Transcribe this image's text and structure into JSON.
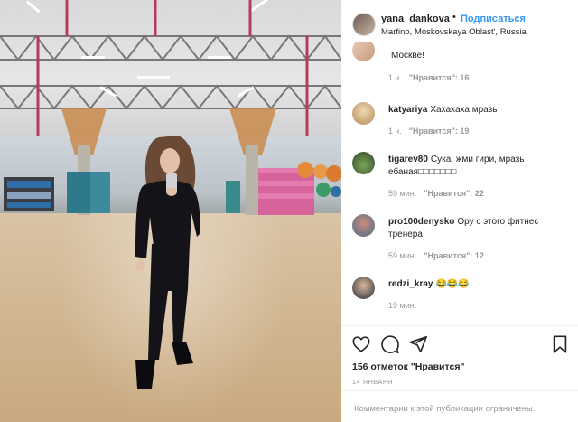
{
  "header": {
    "username": "yana_dankova",
    "separator": "•",
    "follow_label": "Подписаться",
    "location": "Marfino, Moskovskaya Oblast', Russia"
  },
  "comments": [
    {
      "username": "",
      "text": "Москве!",
      "time": "1 ч.",
      "like_label": "\"Нравится\": 16"
    },
    {
      "username": "katyariya",
      "text": "Хахахаха мразь",
      "time": "1 ч.",
      "like_label": "\"Нравится\": 19"
    },
    {
      "username": "tigarev80",
      "text": "Сука, жми гири, мразь ебаная□□□□□□□",
      "time": "59 мин.",
      "like_label": "\"Нравится\": 22"
    },
    {
      "username": "pro100denysko",
      "text": "Ору с этого фитнес тренера",
      "time": "59 мин.",
      "like_label": "\"Нравится\": 12"
    },
    {
      "username": "redzi_kray",
      "text": "😂😂😂",
      "time": "19 мин.",
      "like_label": ""
    }
  ],
  "actions": {
    "like_icon": "heart-icon",
    "comment_icon": "comment-icon",
    "share_icon": "share-icon",
    "save_icon": "bookmark-icon",
    "likes_text": "156 отметок \"Нравится\"",
    "date": "14 ЯНВАРЯ"
  },
  "footer": {
    "comments_disabled": "Комментарии к этой публикации ограничены."
  },
  "colors": {
    "accent": "#3897f0",
    "muted": "#999999",
    "text": "#262626",
    "border": "#efefef"
  }
}
